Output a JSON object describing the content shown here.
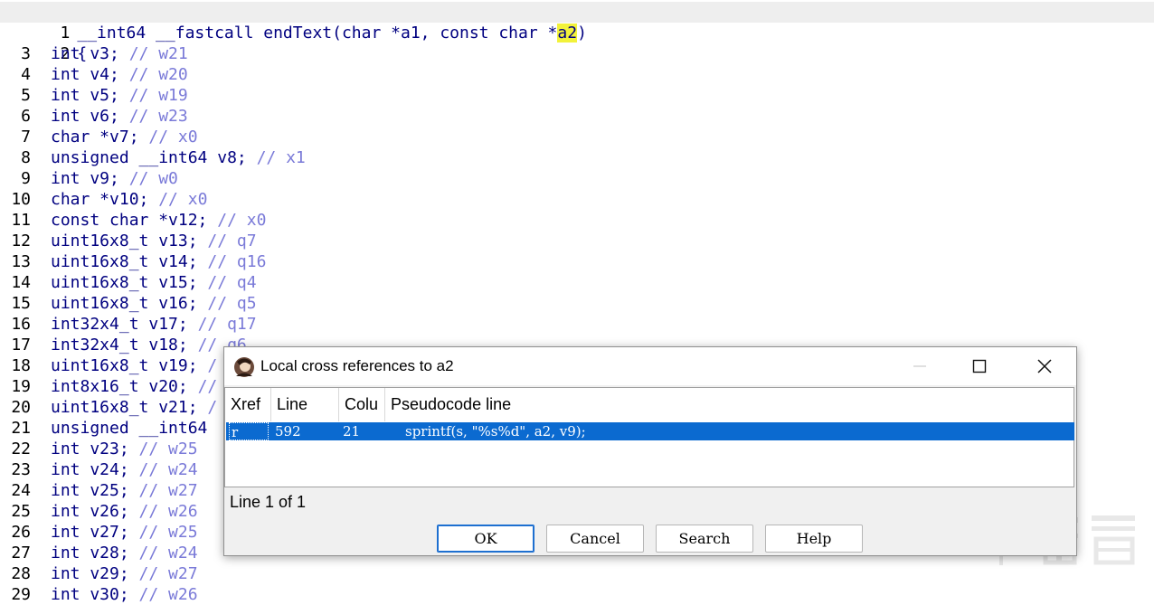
{
  "editor": {
    "lines": [
      {
        "n": "1",
        "text": "__int64 __fastcall endText(char *a1, const char *",
        "hl": "a2",
        "tail": ")"
      },
      {
        "n": "2",
        "text": "{"
      },
      {
        "n": "3",
        "code": "int v3; ",
        "cmt": "// w21"
      },
      {
        "n": "4",
        "code": "int v4; ",
        "cmt": "// w20"
      },
      {
        "n": "5",
        "code": "int v5; ",
        "cmt": "// w19"
      },
      {
        "n": "6",
        "code": "int v6; ",
        "cmt": "// w23"
      },
      {
        "n": "7",
        "code": "char *v7; ",
        "cmt": "// x0"
      },
      {
        "n": "8",
        "code": "unsigned __int64 v8; ",
        "cmt": "// x1"
      },
      {
        "n": "9",
        "code": "int v9; ",
        "cmt": "// w0"
      },
      {
        "n": "10",
        "code": "char *v10; ",
        "cmt": "// x0"
      },
      {
        "n": "11",
        "code": "const char *v12; ",
        "cmt": "// x0"
      },
      {
        "n": "12",
        "code": "uint16x8_t v13; ",
        "cmt": "// q7"
      },
      {
        "n": "13",
        "code": "uint16x8_t v14; ",
        "cmt": "// q16"
      },
      {
        "n": "14",
        "code": "uint16x8_t v15; ",
        "cmt": "// q4"
      },
      {
        "n": "15",
        "code": "uint16x8_t v16; ",
        "cmt": "// q5"
      },
      {
        "n": "16",
        "code": "int32x4_t v17; ",
        "cmt": "// q17"
      },
      {
        "n": "17",
        "code": "int32x4_t v18; ",
        "cmt": "// q6"
      },
      {
        "n": "18",
        "code": "uint16x8_t v19; ",
        "cmt": "/"
      },
      {
        "n": "19",
        "code": "int8x16_t v20; ",
        "cmt": "//"
      },
      {
        "n": "20",
        "code": "uint16x8_t v21; ",
        "cmt": "/"
      },
      {
        "n": "21",
        "code": "unsigned __int64",
        "cmt": ""
      },
      {
        "n": "22",
        "code": "int v23; ",
        "cmt": "// w25"
      },
      {
        "n": "23",
        "code": "int v24; ",
        "cmt": "// w24"
      },
      {
        "n": "24",
        "code": "int v25; ",
        "cmt": "// w27"
      },
      {
        "n": "25",
        "code": "int v26; ",
        "cmt": "// w26"
      },
      {
        "n": "26",
        "code": "int v27; ",
        "cmt": "// w25"
      },
      {
        "n": "27",
        "code": "int v28; ",
        "cmt": "// w24"
      },
      {
        "n": "28",
        "code": "int v29; ",
        "cmt": "// w27"
      },
      {
        "n": "29",
        "code": "int v30; ",
        "cmt": "// w26"
      }
    ]
  },
  "dialog": {
    "title": "Local cross references to a2",
    "columns": [
      "Xref",
      "Line",
      "Colu",
      "Pseudocode line"
    ],
    "rows": [
      {
        "xref": "r",
        "line": "592",
        "col": "21",
        "code": "sprintf(s, \"%s%d\", a2, v9);"
      }
    ],
    "status": "Line 1 of 1",
    "buttons": {
      "ok": "OK",
      "cancel": "Cancel",
      "search": "Search",
      "help": "Help"
    }
  },
  "colors": {
    "selection": "#0b6ad0",
    "code_text": "#000080",
    "comment": "#7a7ad8",
    "highlight": "#f2f23a"
  }
}
